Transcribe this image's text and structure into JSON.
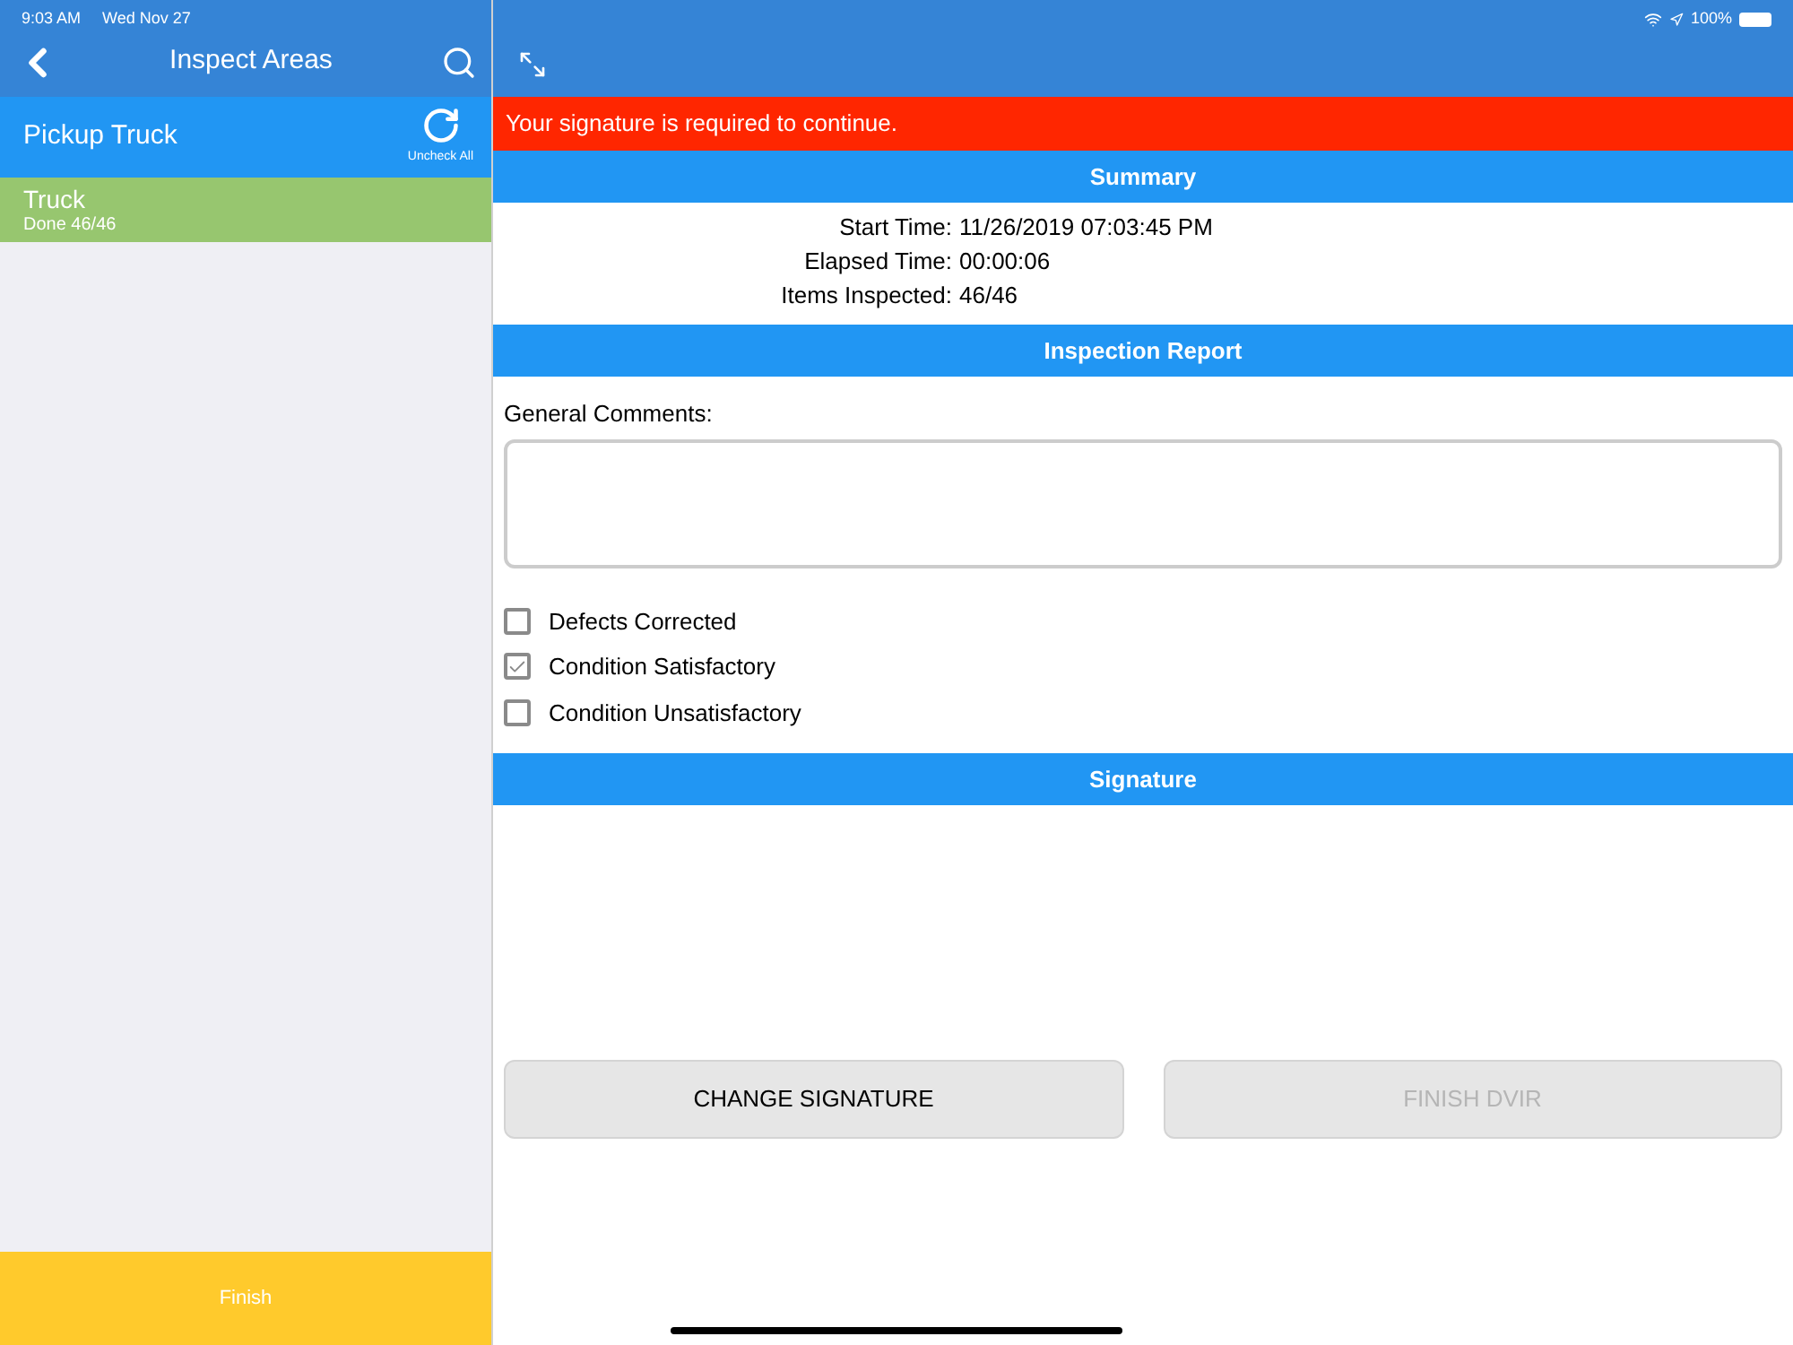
{
  "status_bar": {
    "time": "9:03 AM",
    "date": "Wed Nov 27",
    "battery": "100%"
  },
  "sidebar": {
    "title": "Inspect Areas",
    "group": {
      "title": "Pickup Truck",
      "action": "Uncheck All"
    },
    "items": [
      {
        "title": "Truck",
        "subtitle": "Done 46/46",
        "selected": true
      }
    ],
    "finish": "Finish"
  },
  "banner": "Your signature is required to continue.",
  "summary": {
    "title": "Summary",
    "rows": [
      {
        "label": "Start Time:",
        "value": "11/26/2019 07:03:45 PM"
      },
      {
        "label": "Elapsed Time:",
        "value": "00:00:06"
      },
      {
        "label": "Items Inspected:",
        "value": "46/46"
      }
    ]
  },
  "report": {
    "title": "Inspection Report",
    "comments_label": "General Comments:",
    "options": [
      {
        "label": "Defects Corrected",
        "checked": false
      },
      {
        "label": "Condition Satisfactory",
        "checked": true
      },
      {
        "label": "Condition Unsatisfactory",
        "checked": false
      }
    ]
  },
  "signature": {
    "title": "Signature"
  },
  "buttons": [
    {
      "label": "CHANGE SIGNATURE",
      "disabled": false
    },
    {
      "label": "FINISH DVIR",
      "disabled": true
    }
  ]
}
